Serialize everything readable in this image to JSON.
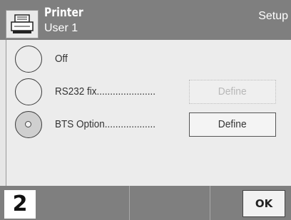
{
  "header": {
    "icon": "printer-icon",
    "title": "Printer",
    "subtitle": "User 1",
    "context": "Setup"
  },
  "options": [
    {
      "label": "Off",
      "dots": "",
      "selected": false,
      "has_define": false
    },
    {
      "label": "RS232 fix",
      "dots": "......................",
      "selected": false,
      "has_define": true,
      "define_label": "Define",
      "define_enabled": false
    },
    {
      "label": "BTS Option",
      "dots": "...................",
      "selected": true,
      "has_define": true,
      "define_label": "Define",
      "define_enabled": true
    }
  ],
  "footer": {
    "screen_number": "2",
    "ok_label": "OK"
  },
  "colors": {
    "header_bg": "#7f7f7f",
    "content_bg": "#ececec",
    "footer_bg": "#7f7f7f"
  }
}
